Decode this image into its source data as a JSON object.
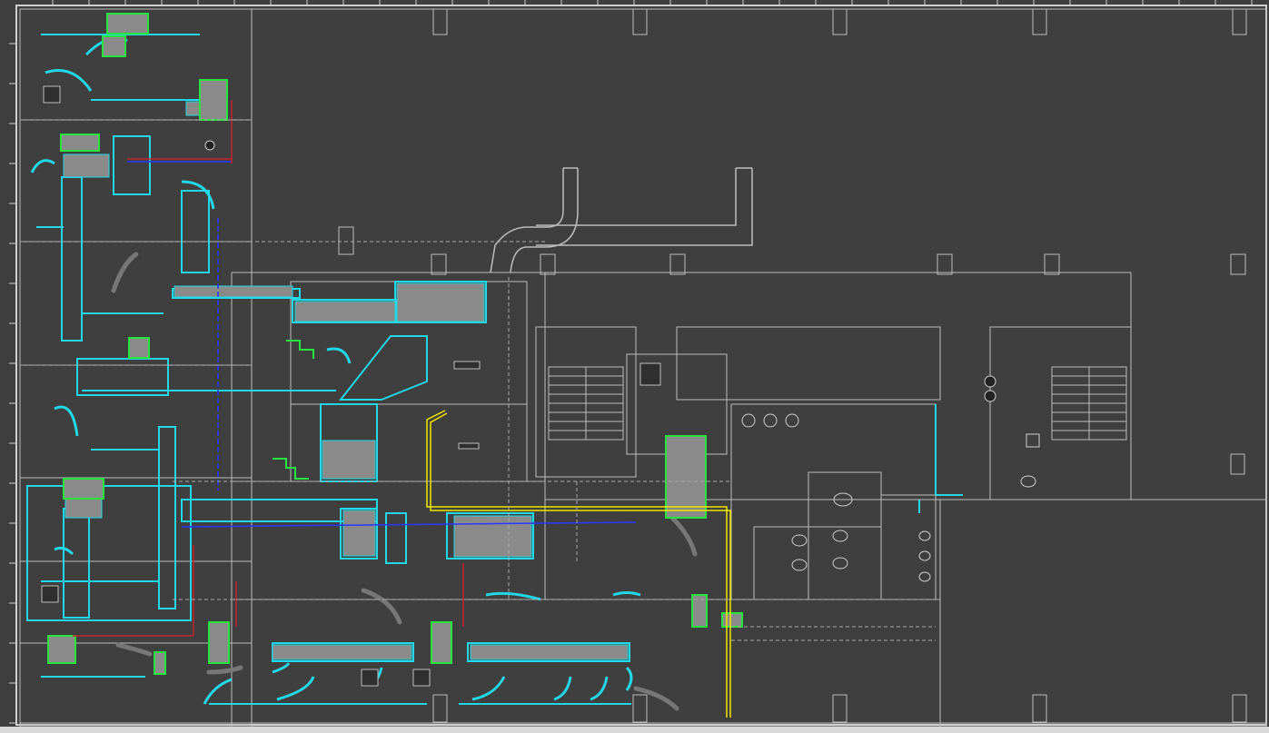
{
  "app": {
    "title": ""
  },
  "drawing": {
    "colors": {
      "background": "#3f3f3f",
      "border": "#cfcfcf",
      "walls": "#bdbdbd",
      "duct": "#23d7e6",
      "equipment": "#29e33f",
      "pipe_red": "#c1272d",
      "pipe_blue": "#2a37ff",
      "pipe_yellow": "#f2e600",
      "text": "#d0d0d0"
    },
    "legend": {
      "items": []
    }
  }
}
